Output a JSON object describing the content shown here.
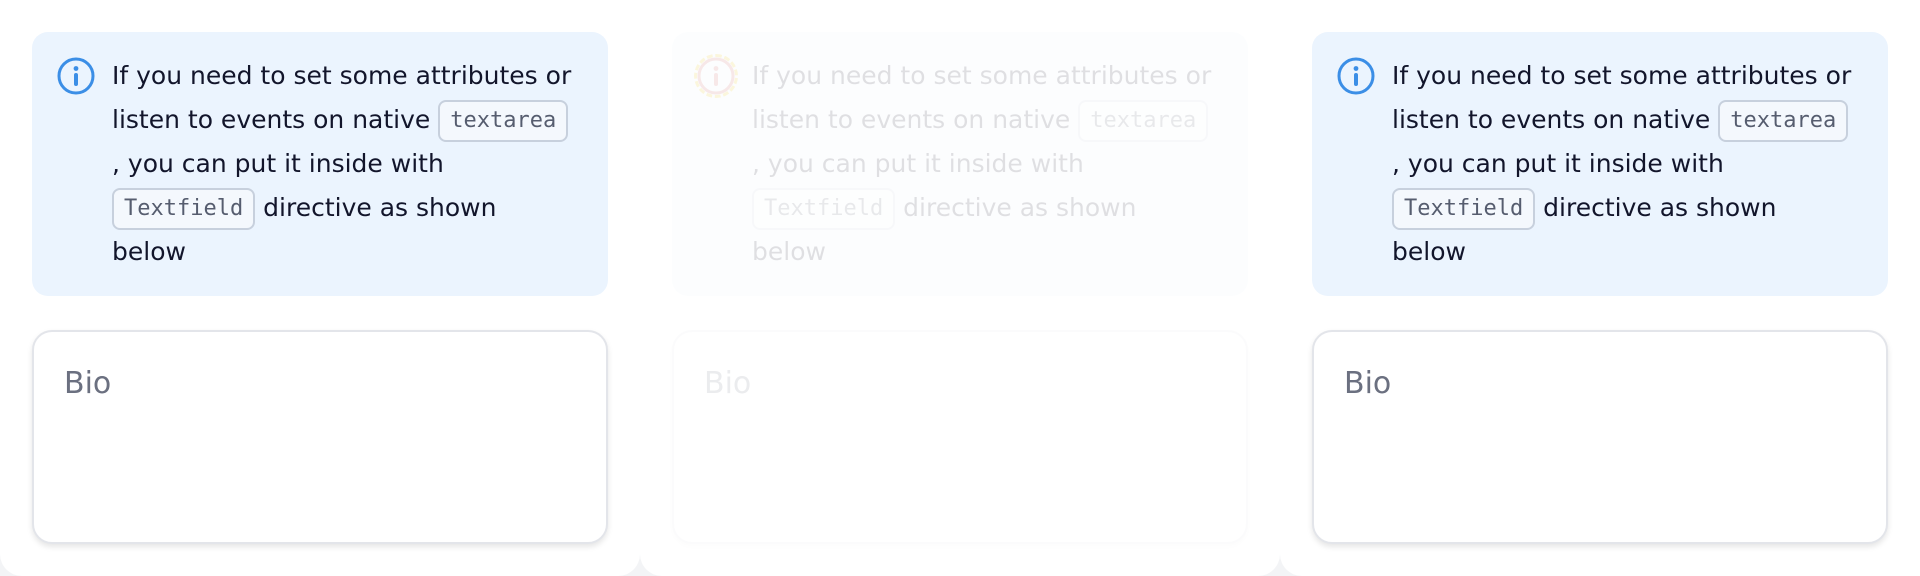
{
  "colors": {
    "accent": "#3b8ee6",
    "alert_background": "#ebf4fe",
    "text": "#12152b",
    "label": "#6b7080",
    "highlight": "#e5c200"
  },
  "columns": [
    {
      "alert": {
        "icon": "info-icon",
        "line1": "If you need to set some attributes or",
        "line2_before": "listen to events on native",
        "code1": "textarea",
        "line3": ", you can put it inside with",
        "code2": "Textfield",
        "line4_after": "directive as shown",
        "line5": "below"
      },
      "field": {
        "label": "Bio"
      }
    },
    {
      "alert": {
        "icon": "info-icon",
        "line1": "If you need to set some attributes or",
        "line2_before": "listen to events on native",
        "code1": "textarea",
        "line3": ", you can put it inside with",
        "code2": "Textfield",
        "line4_after": "directive as shown",
        "line5": "below"
      },
      "field": {
        "label": "Bio"
      }
    },
    {
      "alert": {
        "icon": "info-icon",
        "line1": "If you need to set some attributes or",
        "line2_before": "listen to events on native",
        "code1": "textarea",
        "line3": ", you can put it inside with",
        "code2": "Textfield",
        "line4_after": "directive as shown",
        "line5": "below"
      },
      "field": {
        "label": "Bio"
      }
    }
  ]
}
